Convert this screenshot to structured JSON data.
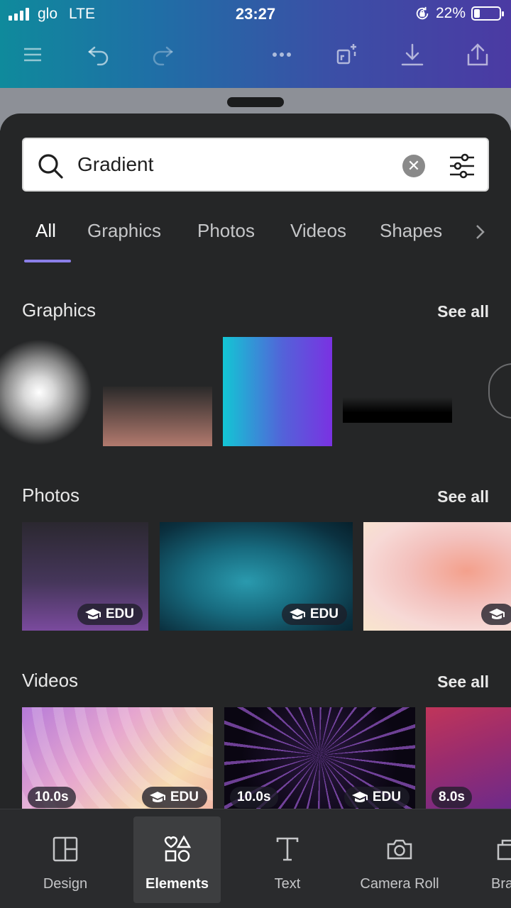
{
  "status_bar": {
    "carrier": "glo",
    "network": "LTE",
    "time": "23:27",
    "battery": "22%"
  },
  "toolbar": {
    "icons": [
      "menu-icon",
      "undo-icon",
      "redo-icon",
      "more-icon",
      "magic-icon",
      "download-icon",
      "share-icon"
    ]
  },
  "search": {
    "query": "Gradient",
    "clear_symbol": "✕"
  },
  "tabs": [
    {
      "label": "All"
    },
    {
      "label": "Graphics"
    },
    {
      "label": "Photos"
    },
    {
      "label": "Videos"
    },
    {
      "label": "Shapes"
    }
  ],
  "sections": {
    "graphics": {
      "title": "Graphics",
      "see_all": "See all"
    },
    "photos": {
      "title": "Photos",
      "see_all": "See all",
      "badge": "EDU"
    },
    "videos": {
      "title": "Videos",
      "see_all": "See all",
      "badge": "EDU",
      "durations": [
        "10.0s",
        "10.0s",
        "8.0s"
      ]
    }
  },
  "nav": [
    {
      "label": "Design"
    },
    {
      "label": "Elements"
    },
    {
      "label": "Text"
    },
    {
      "label": "Camera Roll"
    },
    {
      "label": "Bra"
    }
  ],
  "colors": {
    "accent": "#8b7fe8",
    "sheet_bg": "#252627"
  }
}
